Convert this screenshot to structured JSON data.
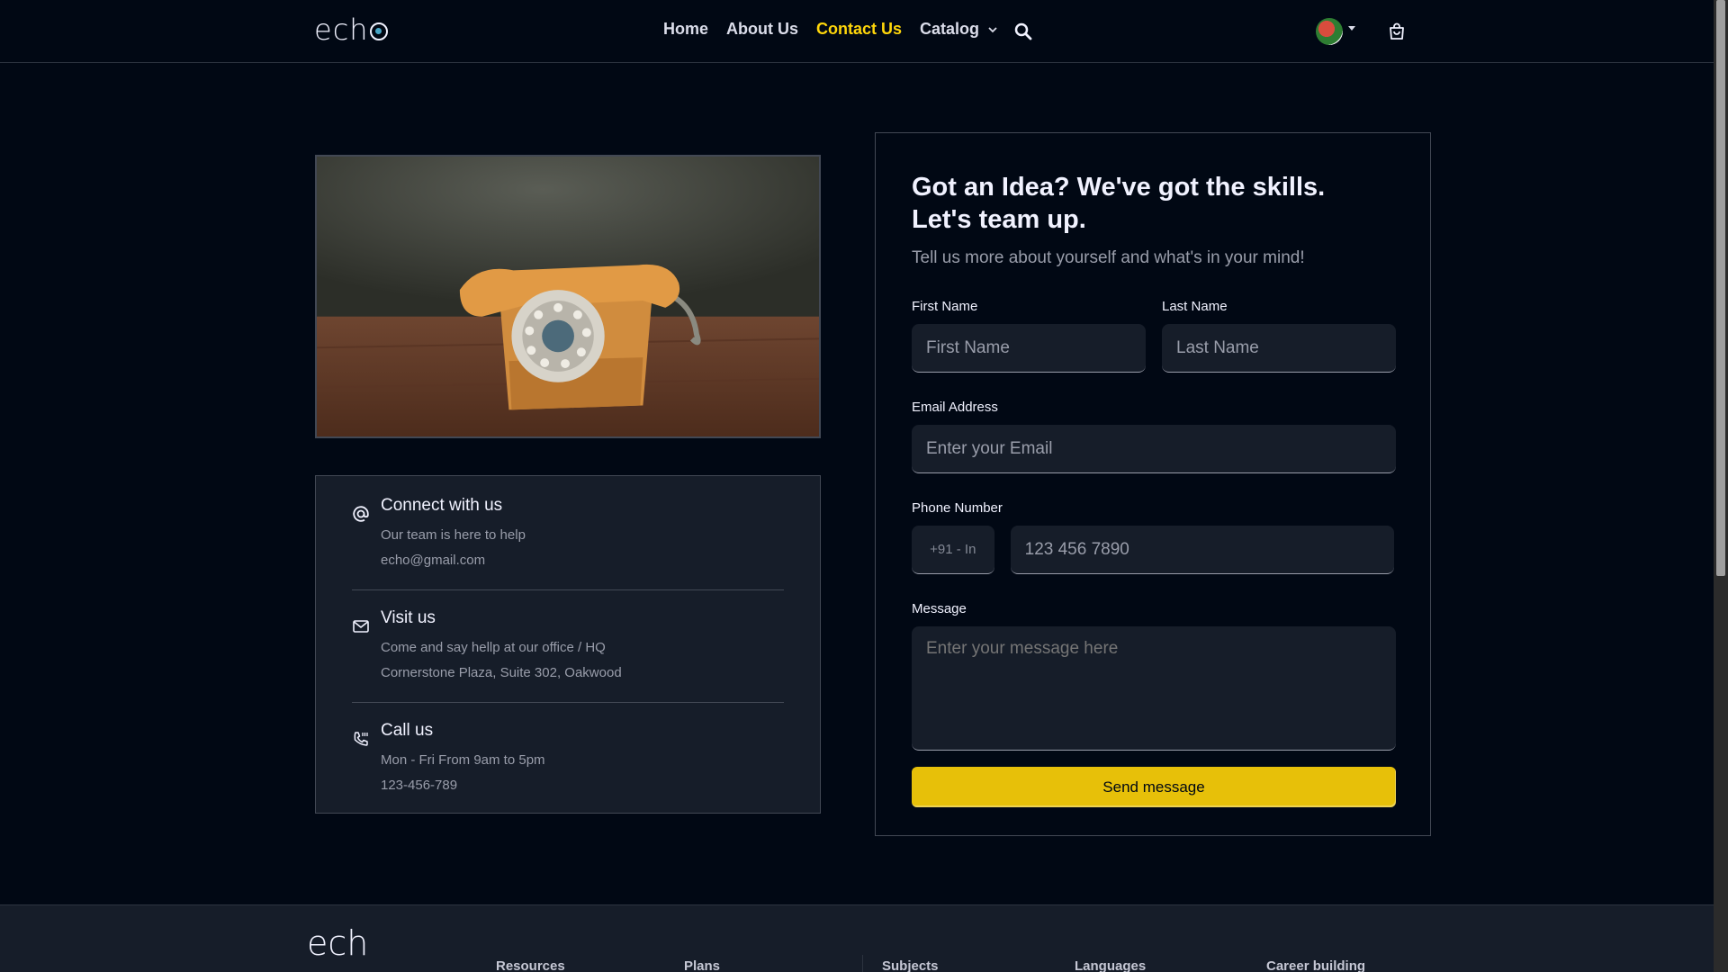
{
  "nav": {
    "logo": "ech",
    "links": [
      {
        "label": "Home"
      },
      {
        "label": "About Us"
      },
      {
        "label": "Contact Us",
        "active": true
      },
      {
        "label": "Catalog"
      }
    ],
    "icons": [
      "search-icon",
      "avatar",
      "cart-icon"
    ]
  },
  "contact_info": [
    {
      "icon": "at-icon",
      "title": "Connect with us",
      "line1": "Our team is here to help",
      "line2": "echo@gmail.com"
    },
    {
      "icon": "mail-icon",
      "title": "Visit us",
      "line1": "Come and say hellp at our office / HQ",
      "line2": "Cornerstone Plaza, Suite 302, Oakwood"
    },
    {
      "icon": "phone-icon",
      "title": "Call us",
      "line1": "Mon - Fri From 9am to 5pm",
      "line2": "123-456-789"
    }
  ],
  "form": {
    "title_line1": "Got an Idea? We've got the skills.",
    "title_line2": "Let's team up.",
    "subtitle": "Tell us more about yourself and what's in your mind!",
    "first_name": {
      "label": "First Name",
      "placeholder": "First Name"
    },
    "last_name": {
      "label": "Last Name",
      "placeholder": "Last Name"
    },
    "email": {
      "label": "Email Address",
      "placeholder": "Enter your Email"
    },
    "phone": {
      "label": "Phone Number",
      "country_code": "+91 - In",
      "placeholder": "123 456 7890"
    },
    "message": {
      "label": "Message",
      "placeholder": "Enter your message here"
    },
    "submit_label": "Send message"
  },
  "footer": {
    "logo": "ech",
    "columns": [
      "Resources",
      "Plans",
      "Subjects",
      "Languages",
      "Career building"
    ]
  },
  "colors": {
    "background": "#010814",
    "accent": "#ffd60a",
    "button": "#e7c009",
    "card": "#161d29"
  }
}
